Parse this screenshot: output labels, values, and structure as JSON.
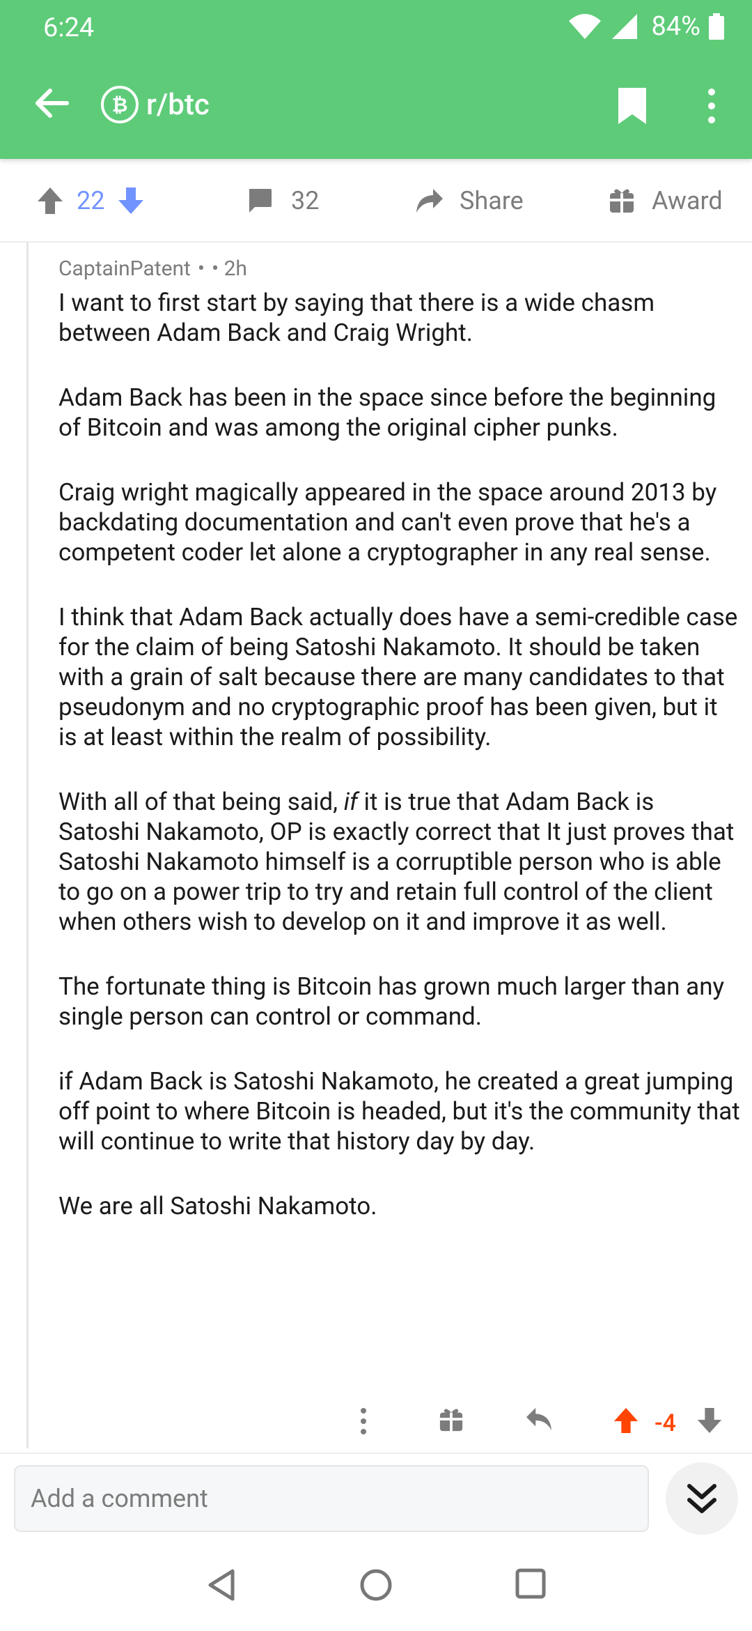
{
  "status_bar": {
    "time": "6:24",
    "battery": "84%",
    "icons": [
      "wifi-icon",
      "signal-icon",
      "battery-icon"
    ]
  },
  "app_bar": {
    "subreddit": "r/btc",
    "icons": [
      "back-arrow-icon",
      "bitcoin-icon",
      "bookmark-icon",
      "more-vertical-icon"
    ],
    "background_color": "#5ecb79"
  },
  "post_actions": {
    "vote_count": "22",
    "comment_count": "32",
    "share_label": "Share",
    "award_label": "Award",
    "vote_color": "#7193ff"
  },
  "comment": {
    "author": "CaptainPatent",
    "separator": "•",
    "age": "• 2h",
    "paragraphs": [
      "I want to first start by saying that there is a wide chasm between Adam Back and Craig Wright.",
      "Adam Back has been in the space since before the beginning of Bitcoin and was among the original cipher punks.",
      "Craig wright magically appeared in the space around 2013 by backdating documentation and can't even prove that he's a competent coder let alone a cryptographer in any real sense.",
      "I think that Adam Back actually does have a semi-credible case for the claim of being Satoshi Nakamoto. It should be taken with a grain of salt because there are many candidates to that pseudonym and no cryptographic proof has been given, but it is at least within the realm of possibility.",
      {
        "before": "With all of that being said, ",
        "italic": "if",
        "after": " it is true that Adam Back is Satoshi Nakamoto, OP is exactly correct that It just proves that Satoshi Nakamoto himself is a corruptible person who is able to go on a power trip to try and retain full control of the client when others wish to develop on it and improve it as well."
      },
      "The fortunate thing is Bitcoin has grown much larger than any single person can control or command.",
      "if Adam Back is Satoshi Nakamoto, he created a great jumping off point to where Bitcoin is headed, but it's the community that will continue to write that history day by day.",
      "We are all Satoshi Nakamoto."
    ],
    "score": "-4",
    "score_color": "#ff4500",
    "action_icons": [
      "more-vertical-icon",
      "gift-icon",
      "reply-icon",
      "upvote-icon",
      "downvote-icon"
    ]
  },
  "composer": {
    "placeholder": "Add a comment",
    "jump_icon": "double-chevron-down-icon"
  },
  "nav_bar": {
    "icons": [
      "back-triangle-icon",
      "home-circle-icon",
      "recents-square-icon"
    ]
  }
}
